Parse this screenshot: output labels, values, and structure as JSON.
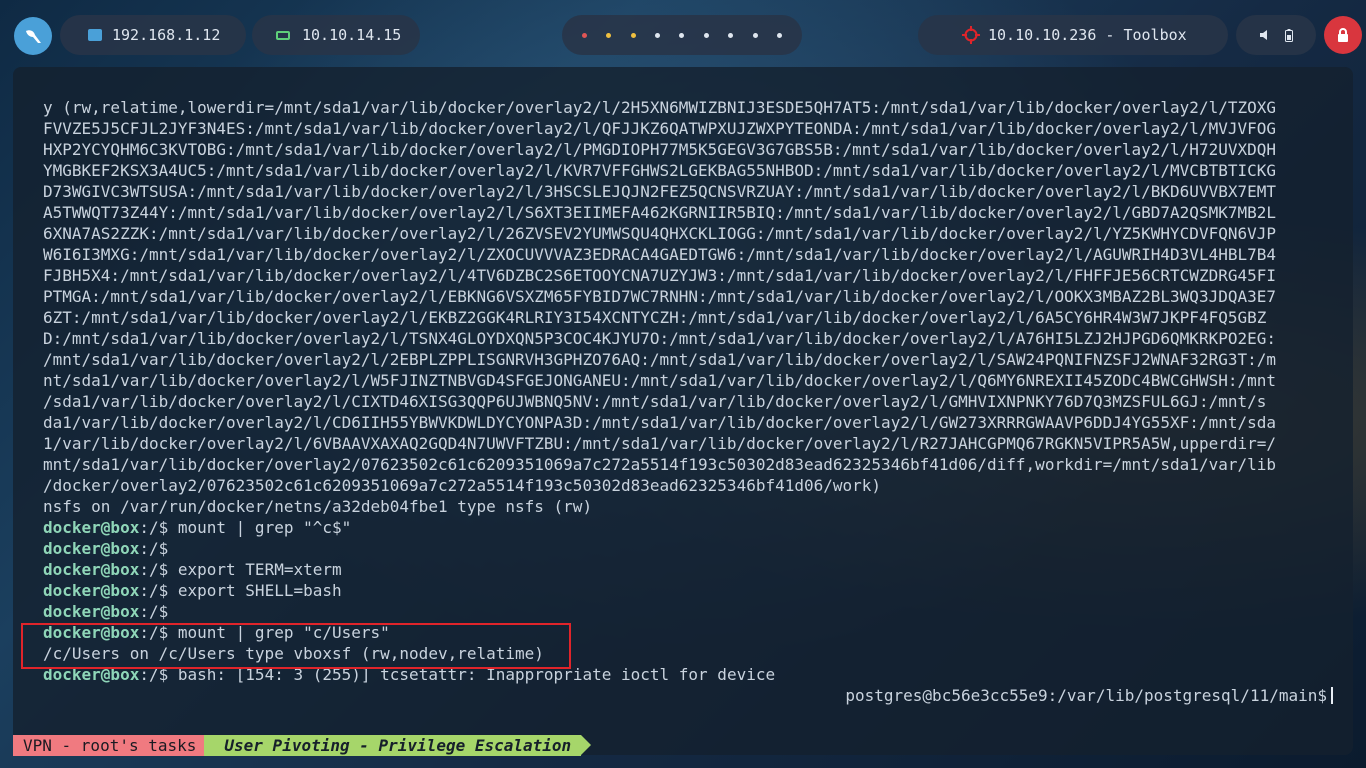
{
  "topbar": {
    "hosts": [
      "192.168.1.12",
      "10.10.14.15"
    ],
    "target": "10.10.10.236 - Toolbox",
    "workspace_dot_colors": [
      "#e05555",
      "#f0c040",
      "#f0c040",
      "#dfe6ef",
      "#dfe6ef",
      "#dfe6ef",
      "#dfe6ef",
      "#dfe6ef",
      "#dfe6ef"
    ],
    "icons": [
      "bird-logo-icon",
      "ethernet-icon",
      "laptop-icon",
      "target-crosshair-icon",
      "speaker-icon",
      "battery-icon",
      "power-icon"
    ]
  },
  "terminal": {
    "lines": [
      "y (rw,relatime,lowerdir=/mnt/sda1/var/lib/docker/overlay2/l/2H5XN6MWIZBNIJ3ESDE5QH7AT5:/mnt/sda1/var/lib/docker/overlay2/l/TZOXG",
      "FVVZE5J5CFJL2JYF3N4ES:/mnt/sda1/var/lib/docker/overlay2/l/QFJJKZ6QATWPXUJZWXPYTEONDA:/mnt/sda1/var/lib/docker/overlay2/l/MVJVFOG",
      "HXP2YCYQHM6C3KVTOBG:/mnt/sda1/var/lib/docker/overlay2/l/PMGDIOPH77M5K5GEGV3G7GBS5B:/mnt/sda1/var/lib/docker/overlay2/l/H72UVXDQH",
      "YMGBKEF2KSX3A4UC5:/mnt/sda1/var/lib/docker/overlay2/l/KVR7VFFGHWS2LGEKBAG55NHBOD:/mnt/sda1/var/lib/docker/overlay2/l/MVCBTBTICKG",
      "D73WGIVC3WTSUSA:/mnt/sda1/var/lib/docker/overlay2/l/3HSCSLEJQJN2FEZ5QCNSVRZUAY:/mnt/sda1/var/lib/docker/overlay2/l/BKD6UVVBX7EMT",
      "A5TWWQT73Z44Y:/mnt/sda1/var/lib/docker/overlay2/l/S6XT3EIIMEFA462KGRNIIR5BIQ:/mnt/sda1/var/lib/docker/overlay2/l/GBD7A2QSMK7MB2L",
      "6XNA7AS2ZZK:/mnt/sda1/var/lib/docker/overlay2/l/26ZVSEV2YUMWSQU4QHXCKLIOGG:/mnt/sda1/var/lib/docker/overlay2/l/YZ5KWHYCDVFQN6VJP",
      "W6I6I3MXG:/mnt/sda1/var/lib/docker/overlay2/l/ZXOCUVVVAZ3EDRACA4GAEDTGW6:/mnt/sda1/var/lib/docker/overlay2/l/AGUWRIH4D3VL4HBL7B4",
      "FJBH5X4:/mnt/sda1/var/lib/docker/overlay2/l/4TV6DZBC2S6ETOOYCNA7UZYJW3:/mnt/sda1/var/lib/docker/overlay2/l/FHFFJE56CRTCWZDRG45FI",
      "PTMGA:/mnt/sda1/var/lib/docker/overlay2/l/EBKNG6VSXZM65FYBID7WC7RNHN:/mnt/sda1/var/lib/docker/overlay2/l/OOKX3MBAZ2BL3WQ3JDQA3E7",
      "6ZT:/mnt/sda1/var/lib/docker/overlay2/l/EKBZ2GGK4RLRIY3I54XCNTYCZH:/mnt/sda1/var/lib/docker/overlay2/l/6A5CY6HR4W3W7JKPF4FQ5GBZ",
      "D:/mnt/sda1/var/lib/docker/overlay2/l/TSNX4GLOYDXQN5P3COC4KJYU7O:/mnt/sda1/var/lib/docker/overlay2/l/A76HI5LZJ2HJPGD6QMKRKPO2EG:",
      "/mnt/sda1/var/lib/docker/overlay2/l/2EBPLZPPLISGNRVH3GPHZO76AQ:/mnt/sda1/var/lib/docker/overlay2/l/SAW24PQNIFNZSFJ2WNAF32RG3T:/m",
      "nt/sda1/var/lib/docker/overlay2/l/W5FJINZTNBVGD4SFGEJONGANEU:/mnt/sda1/var/lib/docker/overlay2/l/Q6MY6NREXII45ZODC4BWCGHWSH:/mnt",
      "/sda1/var/lib/docker/overlay2/l/CIXTD46XISG3QQP6UJWBNQ5NV:/mnt/sda1/var/lib/docker/overlay2/l/GMHVIXNPNKY76D7Q3MZSFUL6GJ:/mnt/s",
      "da1/var/lib/docker/overlay2/l/CD6IIH55YBWVKDWLDYCYONPA3D:/mnt/sda1/var/lib/docker/overlay2/l/GW273XRRRGWAAVP6DDJ4YG55XF:/mnt/sda",
      "1/var/lib/docker/overlay2/l/6VBAAVXAXAQ2GQD4N7UWVFTZBU:/mnt/sda1/var/lib/docker/overlay2/l/R27JAHCGPMQ67RGKN5VIPR5A5W,upperdir=/",
      "mnt/sda1/var/lib/docker/overlay2/07623502c61c6209351069a7c272a5514f193c50302d83ead62325346bf41d06/diff,workdir=/mnt/sda1/var/lib",
      "/docker/overlay2/07623502c61c6209351069a7c272a5514f193c50302d83ead62325346bf41d06/work)",
      "nsfs on /var/run/docker/netns/a32deb04fbe1 type nsfs (rw)"
    ],
    "prompt_user": "docker@box",
    "prompt_path": ":/$",
    "commands": [
      " mount | grep \"^c$\"",
      "",
      " export TERM=xterm",
      " export SHELL=bash",
      "",
      " mount | grep \"c/Users\""
    ],
    "output_line": "/c/Users on /c/Users type vboxsf (rw,nodev,relatime)",
    "last_command": " bash: [154: 3 (255)] tcsetattr: Inappropriate ioctl for device",
    "postgres_prompt": "postgres@bc56e3cc55e9:/var/lib/postgresql/11/main$"
  },
  "statusbar": {
    "session": "VPN - root's tasks",
    "window": "User Pivoting - Privilege Escalation"
  }
}
